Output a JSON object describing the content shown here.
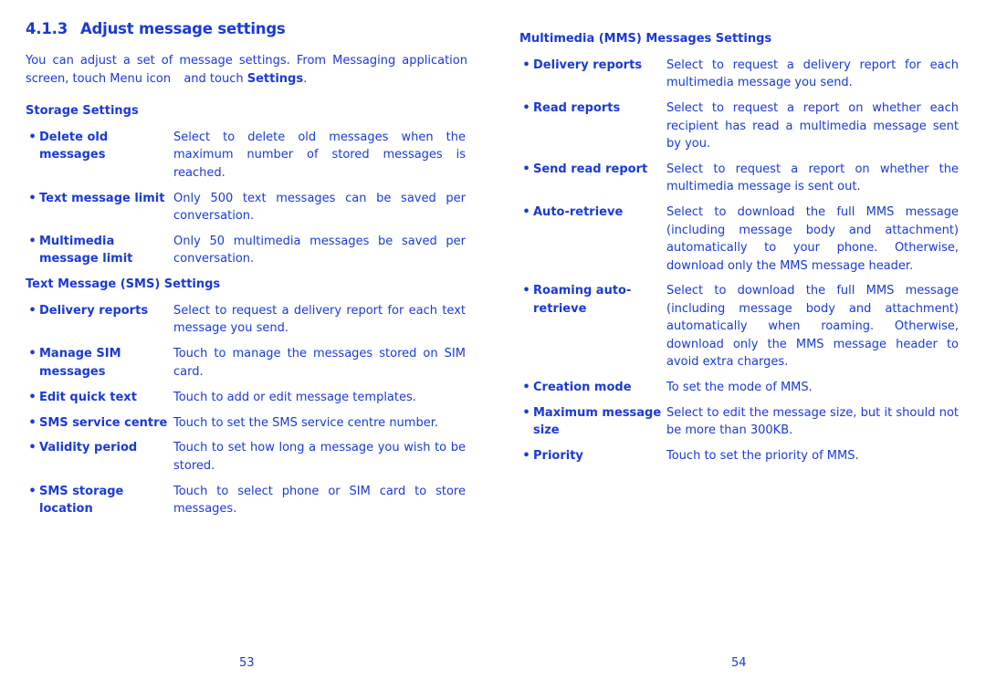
{
  "left_page": {
    "heading_number": "4.1.3",
    "heading_title": "Adjust message settings",
    "intro_part1": "You can adjust a set of message settings. From Messaging application screen, touch Menu icon ",
    "intro_part2": " and touch ",
    "intro_bold": "Settings",
    "intro_end": ".",
    "storage": {
      "title": "Storage Settings",
      "items": [
        {
          "term": "Delete old messages",
          "desc": "Select to delete old messages when the maximum number of stored messages is reached."
        },
        {
          "term": "Text message limit",
          "desc": "Only 500 text messages can be saved per conversation."
        },
        {
          "term": "Multimedia message limit",
          "desc": "Only 50 multimedia messages be saved per conversation."
        }
      ]
    },
    "sms": {
      "title": "Text Message (SMS) Settings",
      "items": [
        {
          "term": "Delivery reports",
          "desc": "Select to request a delivery report for each text message you send."
        },
        {
          "term": "Manage SIM messages",
          "desc": "Touch to manage the messages stored on SIM card."
        },
        {
          "term": "Edit quick text",
          "desc": "Touch to add or edit message templates."
        },
        {
          "term": "SMS service centre",
          "desc": "Touch to set the SMS service centre number."
        },
        {
          "term": "Validity period",
          "desc": "Touch to set how long a message you wish to be stored."
        },
        {
          "term": "SMS storage location",
          "desc": "Touch to select phone or SIM card to store messages."
        }
      ]
    },
    "page_number": "53"
  },
  "right_page": {
    "mms": {
      "title": "Multimedia (MMS) Messages Settings",
      "items": [
        {
          "term": "Delivery reports",
          "desc": "Select to request a delivery report for each multimedia message you send."
        },
        {
          "term": "Read reports",
          "desc": "Select to request a report on whether each recipient has read a multimedia message sent by you."
        },
        {
          "term": "Send read report",
          "desc": "Select to request a report on whether the multimedia message is sent out."
        },
        {
          "term": "Auto-retrieve",
          "desc": "Select to download the full MMS message (including message body and attachment) automatically to your phone. Otherwise, download only the MMS message header."
        },
        {
          "term": "Roaming auto-retrieve",
          "desc": "Select to download the full MMS message (including message body and attachment) automatically when roaming. Otherwise, download only the MMS message header to avoid extra charges."
        },
        {
          "term": "Creation mode",
          "desc": "To set the mode of MMS."
        },
        {
          "term": "Maximum message size",
          "desc": "Select to edit the message size, but it should not be more than 300KB."
        },
        {
          "term": "Priority",
          "desc": "Touch to set the priority of MMS."
        }
      ]
    },
    "page_number": "54"
  },
  "bullet_glyph": "•",
  "colors": {
    "text": "#1a3ad6",
    "background": "#ffffff"
  }
}
